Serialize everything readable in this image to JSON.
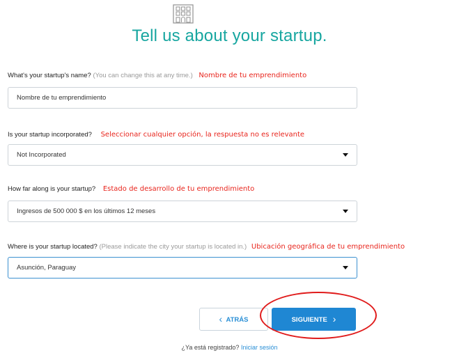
{
  "title": "Tell us about your startup.",
  "icons": {
    "logo": "building-grid-icon",
    "select_caret": "caret-down-icon",
    "back": "chevron-left-icon",
    "next": "chevron-right-icon"
  },
  "colors": {
    "title": "#17a6a0",
    "annotation": "#e8241c",
    "primary_button": "#1f87d3",
    "link": "#2a8fd6"
  },
  "fields": {
    "name": {
      "label": "What's your startup's name?",
      "hint": "(You can change this at any time.)",
      "annotation": "Nombre de tu emprendimiento",
      "placeholder": "Nombre de tu emprendimiento"
    },
    "incorporated": {
      "label": "Is your startup incorporated?",
      "annotation": "Seleccionar cualquier opción, la respuesta no es relevante",
      "value": "Not Incorporated"
    },
    "stage": {
      "label": "How far along is your startup?",
      "annotation": "Estado de desarrollo de tu emprendimiento",
      "value": "Ingresos de 500 000 $ en los últimos 12 meses"
    },
    "location": {
      "label": "Where is your startup located?",
      "hint": "(Please indicate the city your startup is located in.)",
      "annotation": "Ubicación geográfica de tu emprendimiento",
      "value": "Asunción, Paraguay"
    }
  },
  "buttons": {
    "back_label": "ATRÁS",
    "next_label": "SIGUIENTE"
  },
  "footer": {
    "question": "¿Ya está registrado?",
    "login_link": "Iniciar sesión"
  }
}
